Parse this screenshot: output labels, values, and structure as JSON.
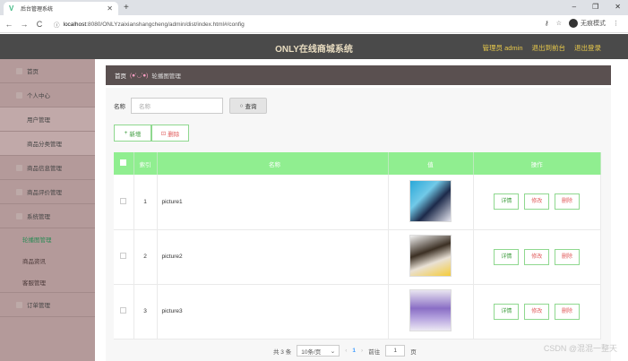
{
  "browser": {
    "tab_title": "后台管理系统",
    "tab_logo": "V",
    "new_tab": "+",
    "url_host": "localhost",
    "url_path": ":8080/ONLYzaixianshangcheng/admin/dist/index.html#/config",
    "incognito_label": "无痕模式",
    "win_min": "–",
    "win_max": "❐",
    "win_close": "✕",
    "back": "←",
    "forward": "→",
    "reload": "C",
    "info": "ⓘ"
  },
  "header": {
    "title": "ONLY在线商城系统",
    "admin_label": "管理员 admin",
    "to_front": "退出到前台",
    "logout": "退出登录"
  },
  "sidebar": {
    "items": [
      {
        "label": "首页"
      },
      {
        "label": "个人中心"
      },
      {
        "label": "用户管理"
      },
      {
        "label": "商品分类管理"
      },
      {
        "label": "商品信息管理"
      },
      {
        "label": "商品评价管理"
      },
      {
        "label": "系统管理"
      },
      {
        "label": "轮播图管理"
      },
      {
        "label": "商品资讯"
      },
      {
        "label": "客服管理"
      },
      {
        "label": "订单管理"
      }
    ]
  },
  "breadcrumb": {
    "home": "首页",
    "sep": "(●'◡'●)",
    "current": "轮播图管理"
  },
  "search": {
    "label": "名称",
    "placeholder": "名称",
    "button": "查询",
    "button_icon": "○"
  },
  "actions": {
    "add": "新增",
    "add_icon": "+",
    "delete": "删除",
    "delete_icon": "⊡"
  },
  "table": {
    "headers": {
      "index": "索引",
      "name": "名称",
      "value": "值",
      "ops": "操作"
    },
    "rows": [
      {
        "index": "1",
        "name": "picture1"
      },
      {
        "index": "2",
        "name": "picture2"
      },
      {
        "index": "3",
        "name": "picture3"
      }
    ],
    "op_detail": "详情",
    "op_edit": "修改",
    "op_delete": "删除"
  },
  "pager": {
    "total": "共 3 条",
    "page_size": "10条/页",
    "prev": "‹",
    "current": "1",
    "next": "›",
    "goto_label": "前往",
    "goto_value": "1",
    "page_unit": "页"
  },
  "watermark": "CSDN @混混一整天",
  "colors": {
    "header_bg": "#4a4a4a",
    "sidebar_bg": "#b49a9a",
    "table_header": "#90ee90",
    "accent_green": "#3a9a3a",
    "danger": "#e05c5c"
  }
}
